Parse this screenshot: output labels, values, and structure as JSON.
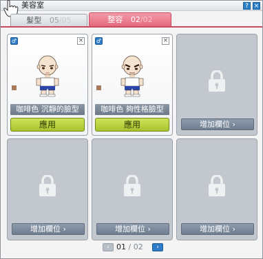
{
  "window": {
    "title": "美容室"
  },
  "titlebar_buttons": {
    "help_glyph": "?",
    "close_glyph": "×"
  },
  "tabs": [
    {
      "label": "髮型",
      "current": "05",
      "separator": "/",
      "total": "05",
      "active": false
    },
    {
      "label": "整容",
      "current": "02",
      "separator": "/",
      "total": "02",
      "active": true
    }
  ],
  "slots": [
    {
      "state": "filled",
      "name": "咖啡色 沉靜的臉型",
      "gender_icon": "male-icon",
      "close_glyph": "×",
      "button_label": "應用",
      "color": "#a67b5e"
    },
    {
      "state": "filled",
      "name": "咖啡色 夠性格臉型",
      "gender_icon": "male-icon",
      "close_glyph": "×",
      "button_label": "應用",
      "color": "#a67b5e"
    },
    {
      "state": "locked",
      "button_label": "增加欄位 ›"
    },
    {
      "state": "locked",
      "button_label": "增加欄位 ›"
    },
    {
      "state": "locked",
      "button_label": "增加欄位 ›"
    },
    {
      "state": "locked",
      "button_label": "增加欄位 ›"
    }
  ],
  "pager": {
    "current": "01",
    "separator": "/",
    "total": "02",
    "prev_glyph": "‹",
    "next_glyph": "›"
  },
  "colors": {
    "active_tab": "#e46a7e",
    "apply_button": "#b9d13a",
    "add_slot_button": "#7b889a",
    "locked_slot": "#c2c8ce"
  }
}
